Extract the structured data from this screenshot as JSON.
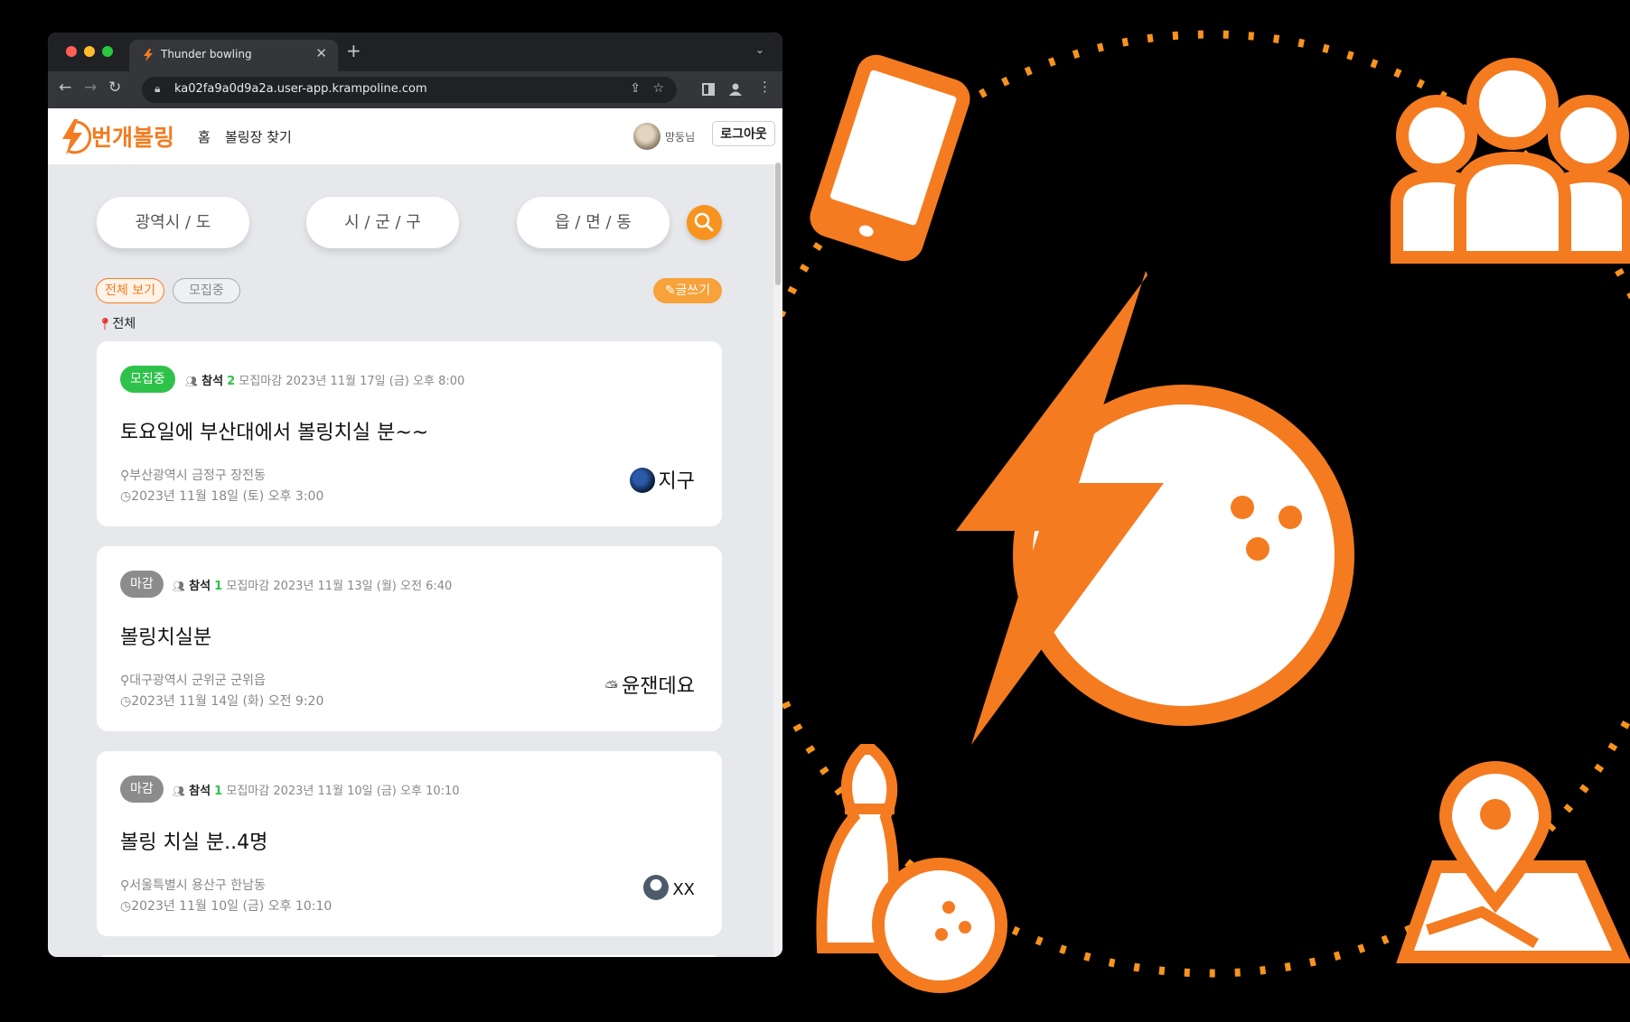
{
  "browser": {
    "tab_title": "Thunder bowling",
    "url": "ka02fa9a0d9a2a.user-app.krampoline.com",
    "new_tab": "+",
    "close": "✕"
  },
  "app": {
    "logo": "번개볼링",
    "nav": [
      "홈",
      "볼링장 찾기"
    ],
    "username": "망둥님",
    "logout": "로그아웃"
  },
  "filters": {
    "selects": [
      "광역시 / 도",
      "시 / 군 / 구",
      "읍 / 면 / 동"
    ],
    "chips": [
      "전체 보기",
      "모집중"
    ],
    "write": "글쓰기",
    "location": "전체"
  },
  "posts": [
    {
      "status": "모집중",
      "status_type": "open",
      "join_label": "참석",
      "join_count": "2",
      "deadline": "모집마감 2023년 11월 17일 (금) 오후 8:00",
      "title": "토요일에 부산대에서 볼링치실 분~~",
      "address": "부산광역시 금정구 장전동",
      "datetime": "2023년 11월 18일 (토) 오후 3:00",
      "host": "지구",
      "host_icon": "earth-avatar"
    },
    {
      "status": "마감",
      "status_type": "closed",
      "join_label": "참석",
      "join_count": "1",
      "deadline": "모집마감 2023년 11월 13일 (월) 오전 6:40",
      "title": "볼링치실분",
      "address": "대구광역시 군위군 군위읍",
      "datetime": "2023년 11월 14일 (화) 오전 9:20",
      "host": "윤잰데요",
      "host_icon": "cloud-sun-icon"
    },
    {
      "status": "마감",
      "status_type": "closed",
      "join_label": "참석",
      "join_count": "1",
      "deadline": "모집마감 2023년 11월 10일 (금) 오후 10:10",
      "title": "볼링 치실 분..4명",
      "address": "서울특별시 용산구 한남동",
      "datetime": "2023년 11월 10일 (금) 오후 10:10",
      "host": "XX",
      "host_icon": "default-user-avatar"
    }
  ],
  "colors": {
    "brand": "#f47b20",
    "open": "#2ec24a",
    "closed": "#8c8c8c"
  }
}
